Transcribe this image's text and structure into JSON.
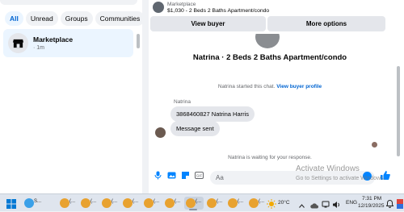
{
  "filters": [
    {
      "label": "All",
      "active": true
    },
    {
      "label": "Unread",
      "active": false
    },
    {
      "label": "Groups",
      "active": false
    },
    {
      "label": "Communities",
      "active": false
    }
  ],
  "conversation": {
    "name": "Marketplace",
    "time": "· 1m",
    "icon": "storefront-icon"
  },
  "header": {
    "source": "Marketplace",
    "listing": "$1,030 - 2 Beds 2 Baths Apartment/condo",
    "view_buyer": "View buyer",
    "more_options": "More options"
  },
  "chat": {
    "title": "Natrina · 2 Beds 2 Baths Apartment/condo",
    "started_prefix": "Natrina started this chat.",
    "started_link": "View buyer profile",
    "sender": "Natrina",
    "messages": [
      "3868460827 Natrina Harris",
      "Message sent"
    ],
    "waiting": "Natrina is waiting for your response."
  },
  "composer": {
    "placeholder": "Aa"
  },
  "watermark": {
    "title": "Activate Windows",
    "subtitle": "Go to Settings to activate Windows."
  },
  "taskbar": {
    "app_labels": [
      "S...",
      "(...",
      "(...",
      "(...",
      "(...",
      "(...",
      "(...",
      "(...",
      "(...",
      "(...",
      "(..."
    ],
    "weather": "20°C",
    "language": "ENG",
    "time": "7:31 PM",
    "date": "12/19/2025"
  },
  "colors": {
    "accent": "#0064d1",
    "messenger_blue": "#0084ff",
    "selected_bg": "#ebf5ff"
  }
}
